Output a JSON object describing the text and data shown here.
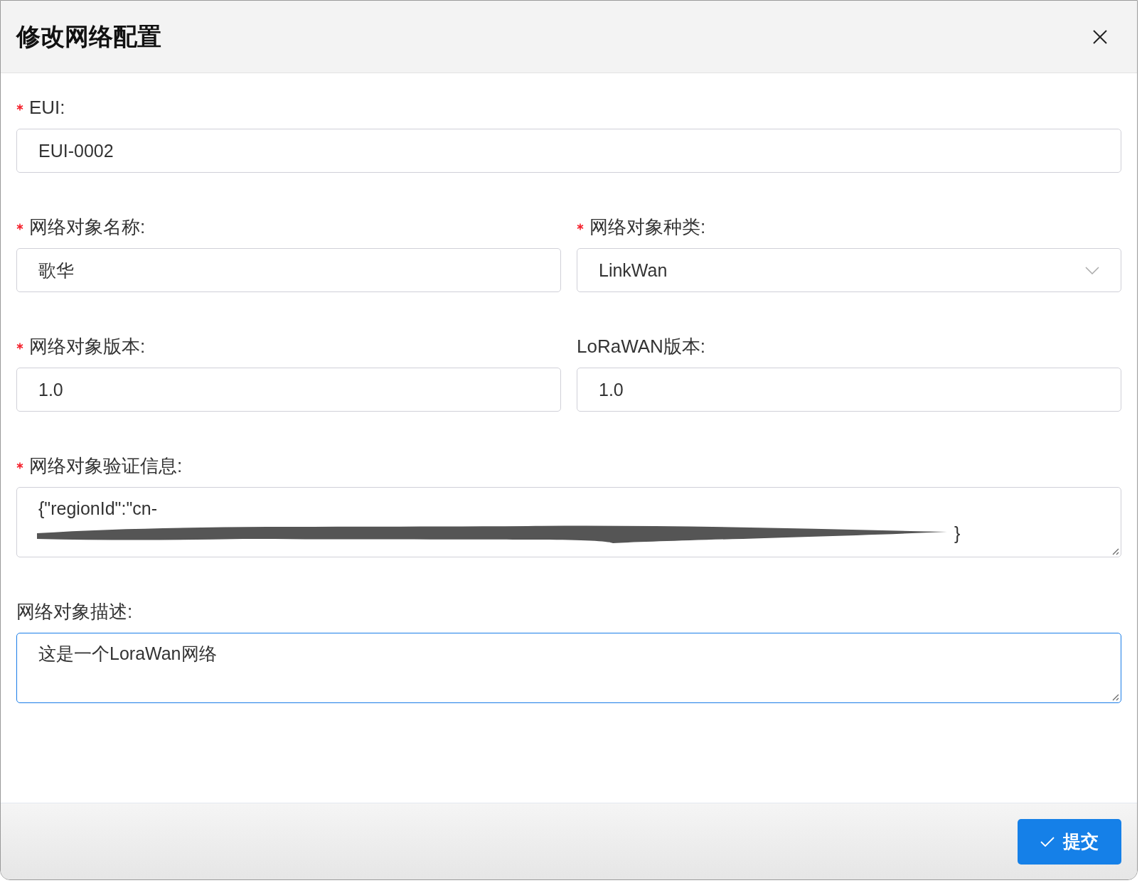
{
  "dialog": {
    "title": "修改网络配置"
  },
  "rows": [
    {
      "fields": [
        {
          "label": "EUI:",
          "required": true,
          "kind": "input",
          "value": "EUI-0002",
          "focused": false
        }
      ]
    },
    {
      "fields": [
        {
          "label": "网络对象名称:",
          "required": true,
          "kind": "input",
          "value": "歌华",
          "focused": false
        },
        {
          "label": "网络对象种类:",
          "required": true,
          "kind": "select",
          "value": "LinkWan",
          "focused": false
        }
      ]
    },
    {
      "fields": [
        {
          "label": "网络对象版本:",
          "required": true,
          "kind": "input",
          "value": "1.0",
          "focused": false
        },
        {
          "label": "LoRaWAN版本:",
          "required": false,
          "kind": "input",
          "value": "1.0",
          "focused": false
        }
      ]
    },
    {
      "fields": [
        {
          "label": "网络对象验证信息:",
          "required": true,
          "kind": "redacted",
          "value": "{\"regionId\":\"cn-",
          "tail": "}",
          "focused": false
        }
      ]
    },
    {
      "fields": [
        {
          "label": "网络对象描述:",
          "required": false,
          "kind": "textarea",
          "value": "这是一个LoraWan网络",
          "focused": true
        }
      ]
    }
  ],
  "footer": {
    "submit": "提交"
  }
}
